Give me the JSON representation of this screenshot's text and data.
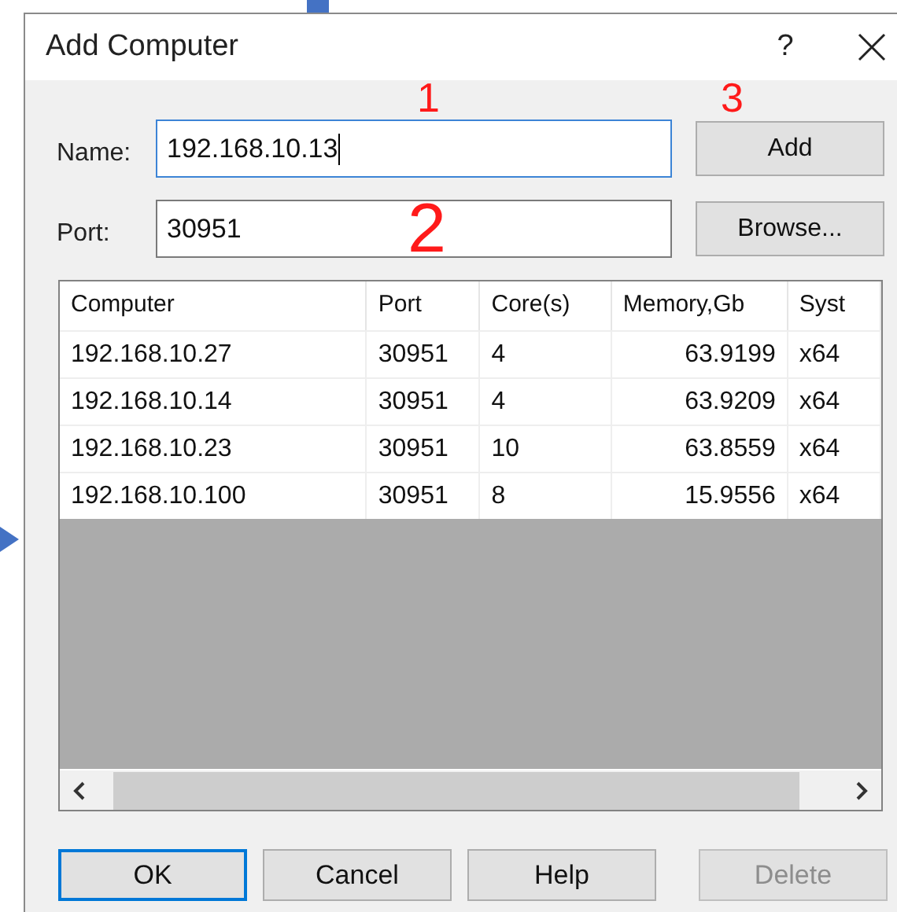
{
  "window": {
    "title": "Add Computer",
    "help": "?"
  },
  "fields": [
    {
      "label": "Name:",
      "value": "192.168.10.13",
      "focused": true,
      "button": "Add"
    },
    {
      "label": "Port:",
      "value": "30951",
      "focused": false,
      "button": "Browse..."
    }
  ],
  "table": {
    "columns": [
      "Computer",
      "Port",
      "Core(s)",
      "Memory,Gb",
      "Syst"
    ],
    "rows": [
      [
        "192.168.10.27",
        "30951",
        "4",
        "63.9199",
        "x64"
      ],
      [
        "192.168.10.14",
        "30951",
        "4",
        "63.9209",
        "x64"
      ],
      [
        "192.168.10.23",
        "30951",
        "10",
        "63.8559",
        "x64"
      ],
      [
        "192.168.10.100",
        "30951",
        "8",
        "15.9556",
        "x64"
      ]
    ]
  },
  "buttons": [
    {
      "label": "OK",
      "default": true,
      "disabled": false
    },
    {
      "label": "Cancel",
      "default": false,
      "disabled": false
    },
    {
      "label": "Help",
      "default": false,
      "disabled": false
    },
    {
      "label": "Delete",
      "default": false,
      "disabled": true
    }
  ],
  "annotations": [
    "1",
    "2",
    "3"
  ]
}
